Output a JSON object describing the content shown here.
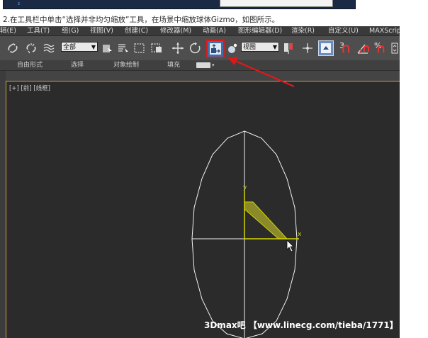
{
  "caption": "2.在工具栏中单击“选择并非均匀缩放”工具，在场景中缩放球体Gizmo，如图所示。",
  "menu": [
    {
      "label": "辑(E)"
    },
    {
      "label": "工具(T)"
    },
    {
      "label": "组(G)"
    },
    {
      "label": "视图(V)"
    },
    {
      "label": "创建(C)"
    },
    {
      "label": "修改器(M)"
    },
    {
      "label": "动画(A)"
    },
    {
      "label": "图形编辑器(D)"
    },
    {
      "label": "渲染(R)"
    },
    {
      "label": "自定义(U)"
    },
    {
      "label": "MAXScrip"
    }
  ],
  "toolbar": {
    "selection_filter": "全部",
    "reference_coord": "视图",
    "snap_label": "3",
    "percent_snap_label": "%",
    "highlighted_tool": "选择并非均匀缩放"
  },
  "ribbon": {
    "tabs": [
      {
        "label": "自由形式"
      },
      {
        "label": "选择"
      },
      {
        "label": "对象绘制"
      },
      {
        "label": "填充"
      }
    ]
  },
  "viewport": {
    "label": "[+] [前] [线框]",
    "gizmo_axes": {
      "x": "x",
      "y": "y"
    }
  },
  "watermark": "3Dmax吧 【www.linecg.com/tieba/1771】",
  "colors": {
    "annotation_red": "#e01818",
    "gizmo_yellow": "#c8c800",
    "viewport_bg": "#2b2b2b",
    "viewport_border": "#c9a64b"
  }
}
